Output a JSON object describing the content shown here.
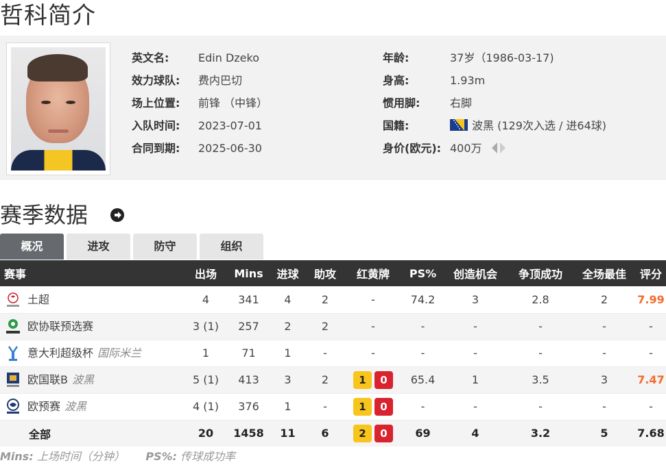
{
  "page": {
    "title": "哲科简介"
  },
  "profile": {
    "fields_left": [
      {
        "label": "英文名:",
        "value": "Edin Dzeko"
      },
      {
        "label": "效力球队:",
        "value": "费内巴切"
      },
      {
        "label": "场上位置:",
        "value": "前锋 （中锋）"
      },
      {
        "label": "入队时间:",
        "value": "2023-07-01"
      },
      {
        "label": "合同到期:",
        "value": "2025-06-30"
      }
    ],
    "fields_right": [
      {
        "label": "年龄:",
        "value": "37岁（1986-03-17)"
      },
      {
        "label": "身高:",
        "value": "1.93m"
      },
      {
        "label": "惯用脚:",
        "value": "右脚"
      },
      {
        "label": "国籍:",
        "value": "波黑 (129次入选 / 进64球)"
      },
      {
        "label": "身价(欧元):",
        "value": "400万"
      }
    ]
  },
  "season": {
    "title": "赛季数据",
    "tabs": [
      "概况",
      "进攻",
      "防守",
      "组织"
    ],
    "active_tab": 0,
    "columns": [
      "赛事",
      "出场",
      "Mins",
      "进球",
      "助攻",
      "红黄牌",
      "PS%",
      "创造机会",
      "争顶成功",
      "全场最佳",
      "评分"
    ],
    "rows": [
      {
        "icon": "super-lig-icon",
        "name": "土超",
        "sub": "",
        "apps": "4",
        "mins": "341",
        "goals": "4",
        "assists": "2",
        "cards": "-",
        "ps": "74.2",
        "chances": "3",
        "aerials": "2.8",
        "motm": "2",
        "rating": "7.99"
      },
      {
        "icon": "conference-league-icon",
        "name": "欧协联预选赛",
        "sub": "",
        "apps": "3 (1)",
        "mins": "257",
        "goals": "2",
        "assists": "2",
        "cards": "-",
        "ps": "-",
        "chances": "-",
        "aerials": "-",
        "motm": "-",
        "rating": "-"
      },
      {
        "icon": "supercoppa-icon",
        "name": "意大利超级杯",
        "sub": "国际米兰",
        "apps": "1",
        "mins": "71",
        "goals": "1",
        "assists": "-",
        "cards": "-",
        "ps": "-",
        "chances": "-",
        "aerials": "-",
        "motm": "-",
        "rating": "-"
      },
      {
        "icon": "nations-league-icon",
        "name": "欧国联B",
        "sub": "波黑",
        "apps": "5 (1)",
        "mins": "413",
        "goals": "3",
        "assists": "2",
        "yellow": "1",
        "red": "0",
        "ps": "65.4",
        "chances": "1",
        "aerials": "3.5",
        "motm": "3",
        "rating": "7.47"
      },
      {
        "icon": "euro-qualifiers-icon",
        "name": "欧预赛",
        "sub": "波黑",
        "apps": "4 (1)",
        "mins": "376",
        "goals": "1",
        "assists": "-",
        "yellow": "1",
        "red": "0",
        "ps": "-",
        "chances": "-",
        "aerials": "-",
        "motm": "-",
        "rating": "-"
      },
      {
        "icon": "",
        "name": "全部",
        "sub": "",
        "apps": "20",
        "mins": "1458",
        "goals": "11",
        "assists": "6",
        "yellow": "2",
        "red": "0",
        "ps": "69",
        "chances": "4",
        "aerials": "3.2",
        "motm": "5",
        "rating": "7.68"
      }
    ]
  },
  "footnote": {
    "mins_key": "Mins:",
    "mins_desc": "上场时间（分钟）",
    "ps_key": "PS%:",
    "ps_desc": "传球成功率"
  },
  "colors": {
    "header_bg": "#343434",
    "active_tab": "#666a6e",
    "rating": "#f36b2c",
    "yellow_card": "#f7c51c",
    "red_card": "#d9232e"
  }
}
